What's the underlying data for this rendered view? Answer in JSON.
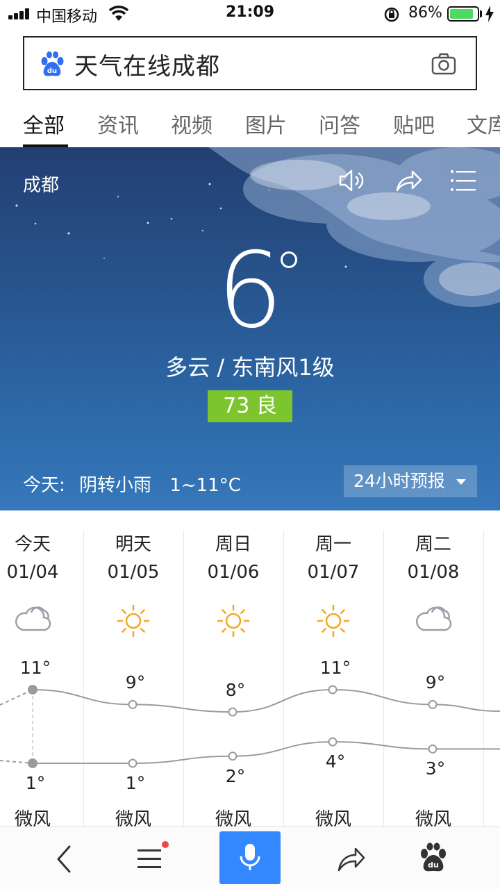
{
  "status_bar": {
    "carrier": "中国移动",
    "time": "21:09",
    "battery_percent": "86%",
    "battery_level": 0.86
  },
  "search": {
    "query": "天气在线成都",
    "logo_icon": "baidu-paw-icon",
    "camera_icon": "camera-icon"
  },
  "tabs": [
    "全部",
    "资讯",
    "视频",
    "图片",
    "问答",
    "贴吧",
    "文库"
  ],
  "hero": {
    "city": "成都",
    "temperature": "6",
    "condition": "多云 / 东南风1级",
    "aqi": "73 良",
    "aqi_color": "#7cc52f",
    "today_label": "今天:",
    "today_summary": "阴转小雨",
    "today_range": "1~11°C",
    "forecast_button": "24小时预报",
    "icons": [
      "speaker-icon",
      "share-icon",
      "menu-icon"
    ]
  },
  "forecast": {
    "days": [
      {
        "day": "今天",
        "date": "01/04",
        "icon": "cloudy-icon",
        "high": "11°",
        "low": "1°",
        "wind": "微风"
      },
      {
        "day": "明天",
        "date": "01/05",
        "icon": "sunny-icon",
        "high": "9°",
        "low": "1°",
        "wind": "微风"
      },
      {
        "day": "周日",
        "date": "01/06",
        "icon": "sunny-icon",
        "high": "8°",
        "low": "2°",
        "wind": "微风"
      },
      {
        "day": "周一",
        "date": "01/07",
        "icon": "sunny-icon",
        "high": "11°",
        "low": "4°",
        "wind": "微风"
      },
      {
        "day": "周二",
        "date": "01/08",
        "icon": "cloudy-icon",
        "high": "9°",
        "low": "3°",
        "wind": "微风"
      }
    ],
    "highs": [
      11,
      9,
      8,
      11,
      9
    ],
    "lows": [
      1,
      1,
      2,
      4,
      3
    ]
  },
  "bottom_bar": {
    "icons": [
      "back-icon",
      "menu-icon",
      "microphone-icon",
      "share-icon",
      "baidu-paw-icon"
    ],
    "accent": "#3388ff"
  }
}
